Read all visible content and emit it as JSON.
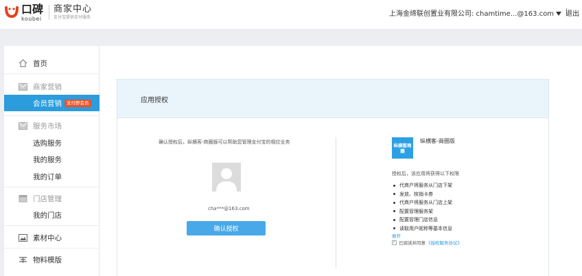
{
  "header": {
    "brand_cn": "口碑",
    "brand_en": "koubei",
    "center_title": "商家中心",
    "center_subtitle": "支付宝提供支付服务",
    "account": "上海金缔联创置业有限公司: chamtime...@163.com",
    "logout": "退出"
  },
  "sidebar": {
    "home": "首页",
    "marketing": "商家营销",
    "member_marketing": "会员营销",
    "member_badge": "支付即会员",
    "service_market": "服务市场",
    "buy_service": "选购服务",
    "my_service": "我的服务",
    "my_orders": "我的订单",
    "store_mgmt": "门店管理",
    "my_store": "我的门店",
    "material": "素材中心",
    "template": "物料模版"
  },
  "content": {
    "title": "应用授权",
    "description": "确认授权后，纵横客-商圈版可以帮助您管理支付宝的相应业务",
    "account_email": "cha***@163.com",
    "confirm_button": "确认授权",
    "app_logo_text": "纵横客商圈",
    "app_name": "纵横客-商圈版",
    "permission_heading": "授权后，该应用将获得以下权限",
    "permissions": [
      "代商户将服务从门店下架",
      "发放、核销卡券",
      "代商户将服务从门店上架",
      "配置管理服务架",
      "配置管理门店信息",
      "读取用户昵称等基本信息"
    ],
    "expand": "展开",
    "agree_text": "已阅读并同意",
    "agree_link": "《授权服务协议》"
  }
}
